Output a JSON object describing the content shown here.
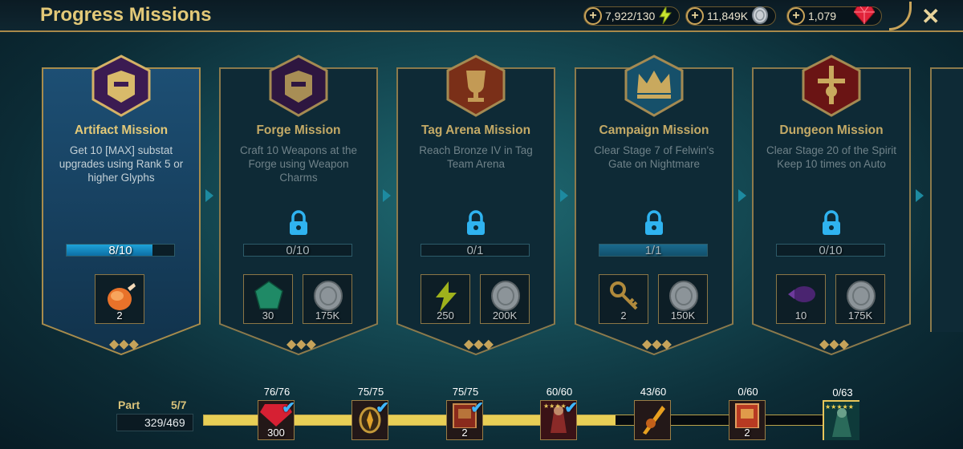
{
  "header": {
    "title": "Progress Missions",
    "close_label": "✕"
  },
  "resources": [
    {
      "name": "energy",
      "value": "7,922/130",
      "icon": "lightning-icon"
    },
    {
      "name": "silver",
      "value": "11,849K",
      "icon": "silver-coin-icon"
    },
    {
      "name": "gems",
      "value": "1,079",
      "icon": "ruby-icon"
    }
  ],
  "missions": [
    {
      "title": "Artifact Mission",
      "desc": "Get 10 [MAX] substat upgrades using Rank 5 or higher Glyphs",
      "progress": "8/10",
      "fraction": 0.8,
      "locked": false,
      "emblem": "shield-helmet-emblem",
      "rewards": [
        {
          "icon": "chicken-icon",
          "value": "2"
        }
      ]
    },
    {
      "title": "Forge Mission",
      "desc": "Craft 10 Weapons at the Forge using Weapon Charms",
      "progress": "0/10",
      "fraction": 0,
      "locked": true,
      "emblem": "shield-helmet-emblem",
      "rewards": [
        {
          "icon": "gem-shard-icon",
          "value": "30"
        },
        {
          "icon": "silver-coin-icon",
          "value": "175K"
        }
      ]
    },
    {
      "title": "Tag Arena Mission",
      "desc": "Reach Bronze IV in Tag Team Arena",
      "progress": "0/1",
      "fraction": 0,
      "locked": true,
      "emblem": "trophy-emblem",
      "rewards": [
        {
          "icon": "lightning-icon",
          "value": "250"
        },
        {
          "icon": "silver-coin-icon",
          "value": "200K"
        }
      ]
    },
    {
      "title": "Campaign Mission",
      "desc": "Clear Stage 7 of Felwin's Gate on Nightmare",
      "progress": "1/1",
      "fraction": 1,
      "locked": true,
      "emblem": "crown-emblem",
      "rewards": [
        {
          "icon": "key-icon",
          "value": "2"
        },
        {
          "icon": "silver-coin-icon",
          "value": "150K"
        }
      ]
    },
    {
      "title": "Dungeon Mission",
      "desc": "Clear Stage 20 of the Spirit Keep 10 times on Auto",
      "progress": "0/10",
      "fraction": 0,
      "locked": true,
      "emblem": "dungeon-emblem",
      "rewards": [
        {
          "icon": "potion-icon",
          "value": "10"
        },
        {
          "icon": "silver-coin-icon",
          "value": "175K"
        }
      ]
    }
  ],
  "part": {
    "label": "Part",
    "value": "5/7",
    "points": "329/469",
    "fraction": 0.655
  },
  "milestones": [
    {
      "count": "76/76",
      "reward": "300",
      "icon": "ruby-icon",
      "done": true
    },
    {
      "count": "75/75",
      "reward": "",
      "icon": "amulet-icon",
      "done": true
    },
    {
      "count": "75/75",
      "reward": "2",
      "icon": "book-icon",
      "done": true
    },
    {
      "count": "60/60",
      "reward": "",
      "icon": "champion-icon",
      "done": true
    },
    {
      "count": "43/60",
      "reward": "",
      "icon": "gold-weapon-icon",
      "done": false
    },
    {
      "count": "0/60",
      "reward": "2",
      "icon": "book-icon",
      "done": false
    },
    {
      "count": "0/63",
      "reward": "",
      "icon": "legendary-champion-icon",
      "done": false
    }
  ]
}
